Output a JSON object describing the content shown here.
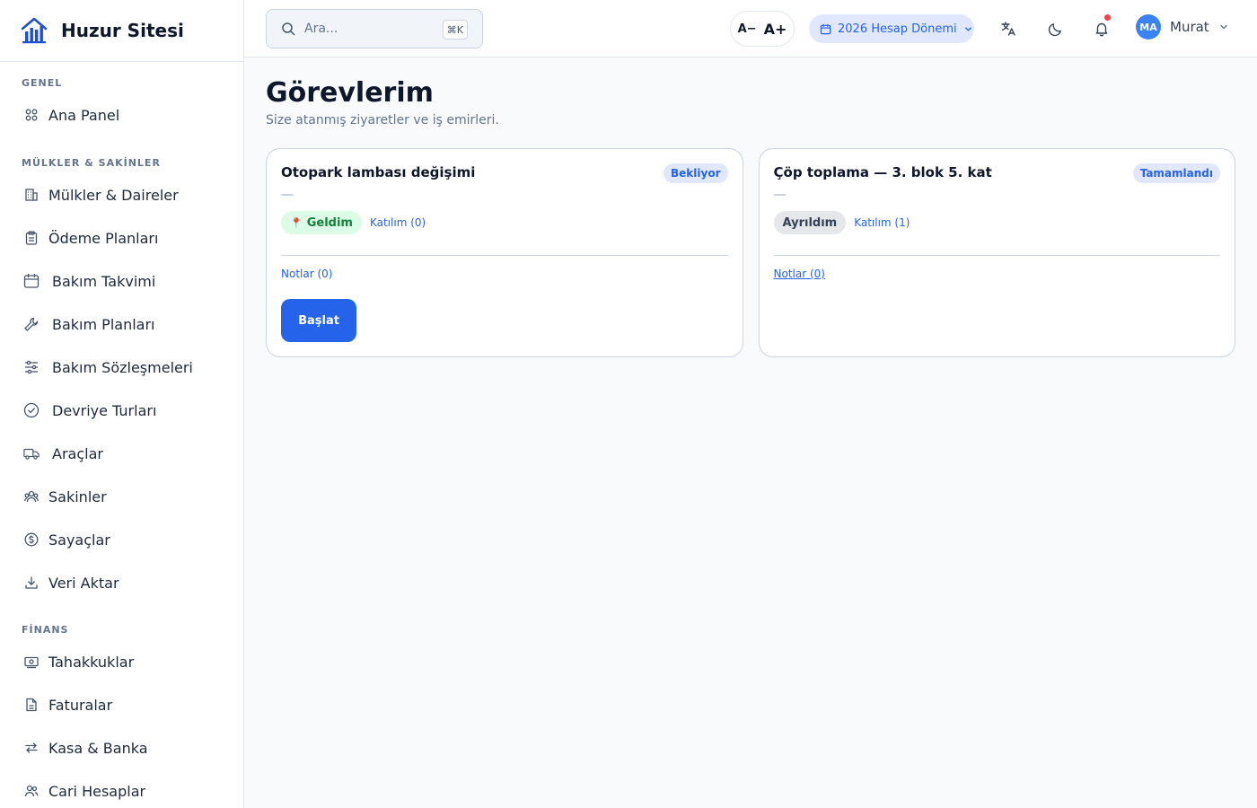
{
  "app": {
    "name": "Huzur Sitesi"
  },
  "sidebar": {
    "sections": [
      {
        "title": "GENEL",
        "items": [
          {
            "label": "Ana Panel",
            "icon": "grid-icon"
          }
        ]
      },
      {
        "title": "MÜLKLER & SAKİNLER",
        "items": [
          {
            "label": "Mülkler & Daireler",
            "icon": "building-icon"
          },
          {
            "label": "Ödeme Planları",
            "icon": "clipboard-icon"
          },
          {
            "label": "Bakım Takvimi",
            "icon": "calendar-icon"
          },
          {
            "label": "Bakım Planları",
            "icon": "wrench-icon"
          },
          {
            "label": "Bakım Sözleşmeleri",
            "icon": "sliders-icon"
          },
          {
            "label": "Devriye Turları",
            "icon": "check-circle-icon"
          },
          {
            "label": "Araçlar",
            "icon": "truck-icon"
          },
          {
            "label": "Sakinler",
            "icon": "users-icon"
          },
          {
            "label": "Sayaçlar",
            "icon": "dollar-circle-icon"
          },
          {
            "label": "Veri Aktar",
            "icon": "download-icon"
          }
        ]
      },
      {
        "title": "FİNANS",
        "items": [
          {
            "label": "Tahakkuklar",
            "icon": "cash-icon"
          },
          {
            "label": "Faturalar",
            "icon": "document-icon"
          },
          {
            "label": "Kasa & Banka",
            "icon": "transfer-icon"
          },
          {
            "label": "Cari Hesaplar",
            "icon": "people-icon"
          }
        ]
      }
    ]
  },
  "topbar": {
    "search_placeholder": "Ara...",
    "search_shortcut": "⌘K",
    "font_decrease": "A−",
    "font_increase": "A+",
    "period": "2026 Hesap Dönemi",
    "user": {
      "initials": "MA",
      "name": "Murat"
    }
  },
  "page": {
    "title": "Görevlerim",
    "subtitle": "Size atanmış ziyaretler ve iş emirleri."
  },
  "tasks": [
    {
      "title": "Otopark lambası değişimi",
      "status": "Bekliyor",
      "description": "—",
      "attendance": "Geldim",
      "participation": "Katılım (0)",
      "notes": "Notlar (0)",
      "action": "Başlat"
    },
    {
      "title": "Çöp toplama — 3. blok 5. kat",
      "status": "Tamamlandı",
      "description": "—",
      "attendance": "Ayrıldım",
      "participation": "Katılım (1)",
      "notes": "Notlar (0)"
    }
  ],
  "colors": {
    "accent": "#2563eb",
    "success": "#15803d",
    "alert": "#ef4444"
  }
}
